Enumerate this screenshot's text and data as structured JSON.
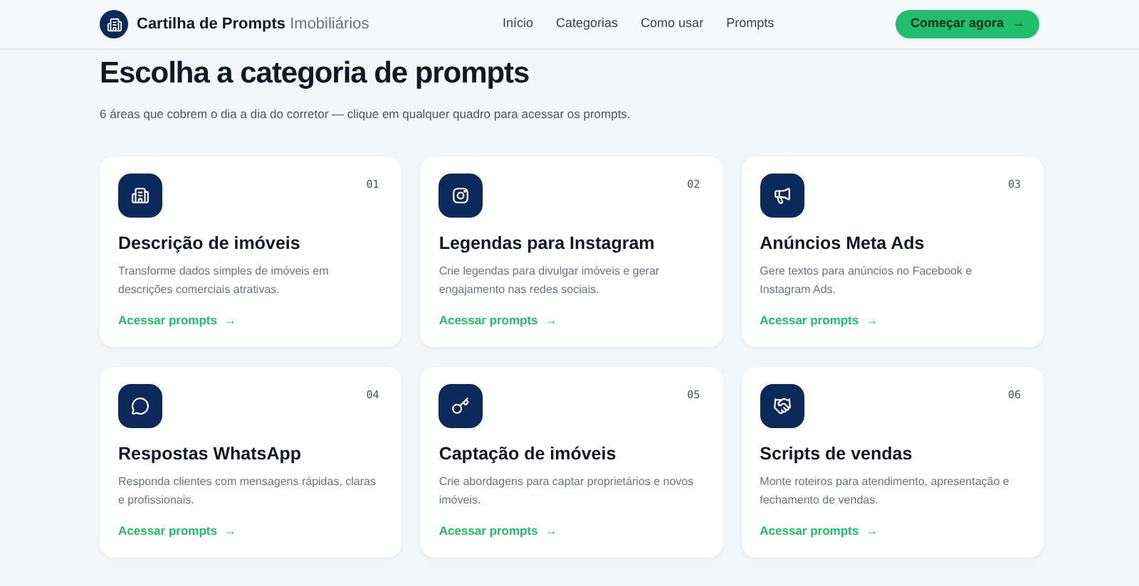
{
  "brand": {
    "name": "Cartilha de Prompts",
    "suffix": "Imobiliários"
  },
  "nav": [
    "Início",
    "Categorias",
    "Como usar",
    "Prompts"
  ],
  "cta": {
    "label": "Começar agora",
    "arrow": "→"
  },
  "heading": "Escolha a categoria de prompts",
  "subtitle": "6 áreas que cobrem o dia a dia do corretor — clique em qualquer quadro para acessar os prompts.",
  "cards": [
    {
      "kind": "building",
      "number": "01",
      "title": "Descrição de imóveis",
      "text": "Transforme dados simples de imóveis em descrições comerciais atrativas.",
      "link": "Acessar prompts",
      "arrow": "→"
    },
    {
      "kind": "instagram",
      "number": "02",
      "title": "Legendas para Instagram",
      "text": "Crie legendas para divulgar imóveis e gerar engajamento nas redes sociais.",
      "link": "Acessar prompts",
      "arrow": "→"
    },
    {
      "kind": "megaphone",
      "number": "03",
      "title": "Anúncios Meta Ads",
      "text": "Gere textos para anúncios no Facebook e Instagram Ads.",
      "link": "Acessar prompts",
      "arrow": "→"
    },
    {
      "kind": "chat",
      "number": "04",
      "title": "Respostas WhatsApp",
      "text": "Responda clientes com mensagens rápidas, claras e profissionais.",
      "link": "Acessar prompts",
      "arrow": "→"
    },
    {
      "kind": "key",
      "number": "05",
      "title": "Captação de imóveis",
      "text": "Crie abordagens para captar proprietários e novos imóveis.",
      "link": "Acessar prompts",
      "arrow": "→"
    },
    {
      "kind": "handshake",
      "number": "06",
      "title": "Scripts de vendas",
      "text": "Monte roteiros para atendimento, apresentação e fechamento de vendas.",
      "link": "Acessar prompts",
      "arrow": "→"
    }
  ]
}
